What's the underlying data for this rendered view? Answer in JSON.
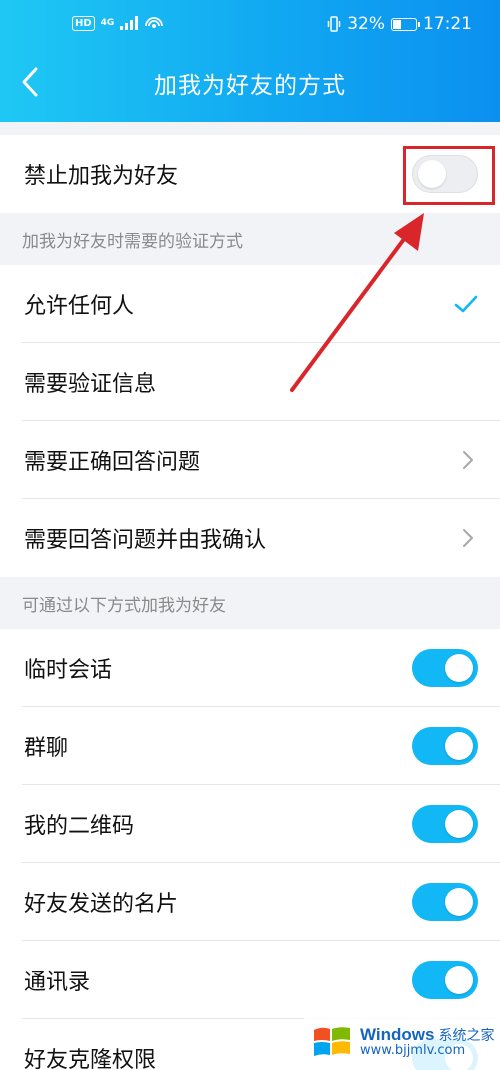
{
  "status_bar": {
    "network": "4G",
    "battery": "32%",
    "time": "17:21"
  },
  "header": {
    "title": "加我为好友的方式"
  },
  "block_disable": {
    "label": "禁止加我为好友",
    "toggle_on": false
  },
  "verification": {
    "section_label": "加我为好友时需要的验证方式",
    "options": [
      {
        "label": "允许任何人",
        "trailing": "check-icon"
      },
      {
        "label": "需要验证信息",
        "trailing": "none"
      },
      {
        "label": "需要正确回答问题",
        "trailing": "chevron-right-icon"
      },
      {
        "label": "需要回答问题并由我确认",
        "trailing": "chevron-right-icon"
      }
    ]
  },
  "methods": {
    "section_label": "可通过以下方式加我为好友",
    "items": [
      {
        "label": "临时会话",
        "toggle_on": true
      },
      {
        "label": "群聊",
        "toggle_on": true
      },
      {
        "label": "我的二维码",
        "toggle_on": true
      },
      {
        "label": "好友发送的名片",
        "toggle_on": true
      },
      {
        "label": "通讯录",
        "toggle_on": true
      },
      {
        "label": "好友克隆权限",
        "toggle_on": true
      }
    ]
  },
  "watermark": {
    "brand": "Windows",
    "brand_cn": "系统之家",
    "url": "www.bjjmlv.com"
  },
  "colors": {
    "header_start": "#1fc8f4",
    "header_end": "#0b90f0",
    "accent": "#12b7f5",
    "annotation_red": "#d8262b"
  }
}
